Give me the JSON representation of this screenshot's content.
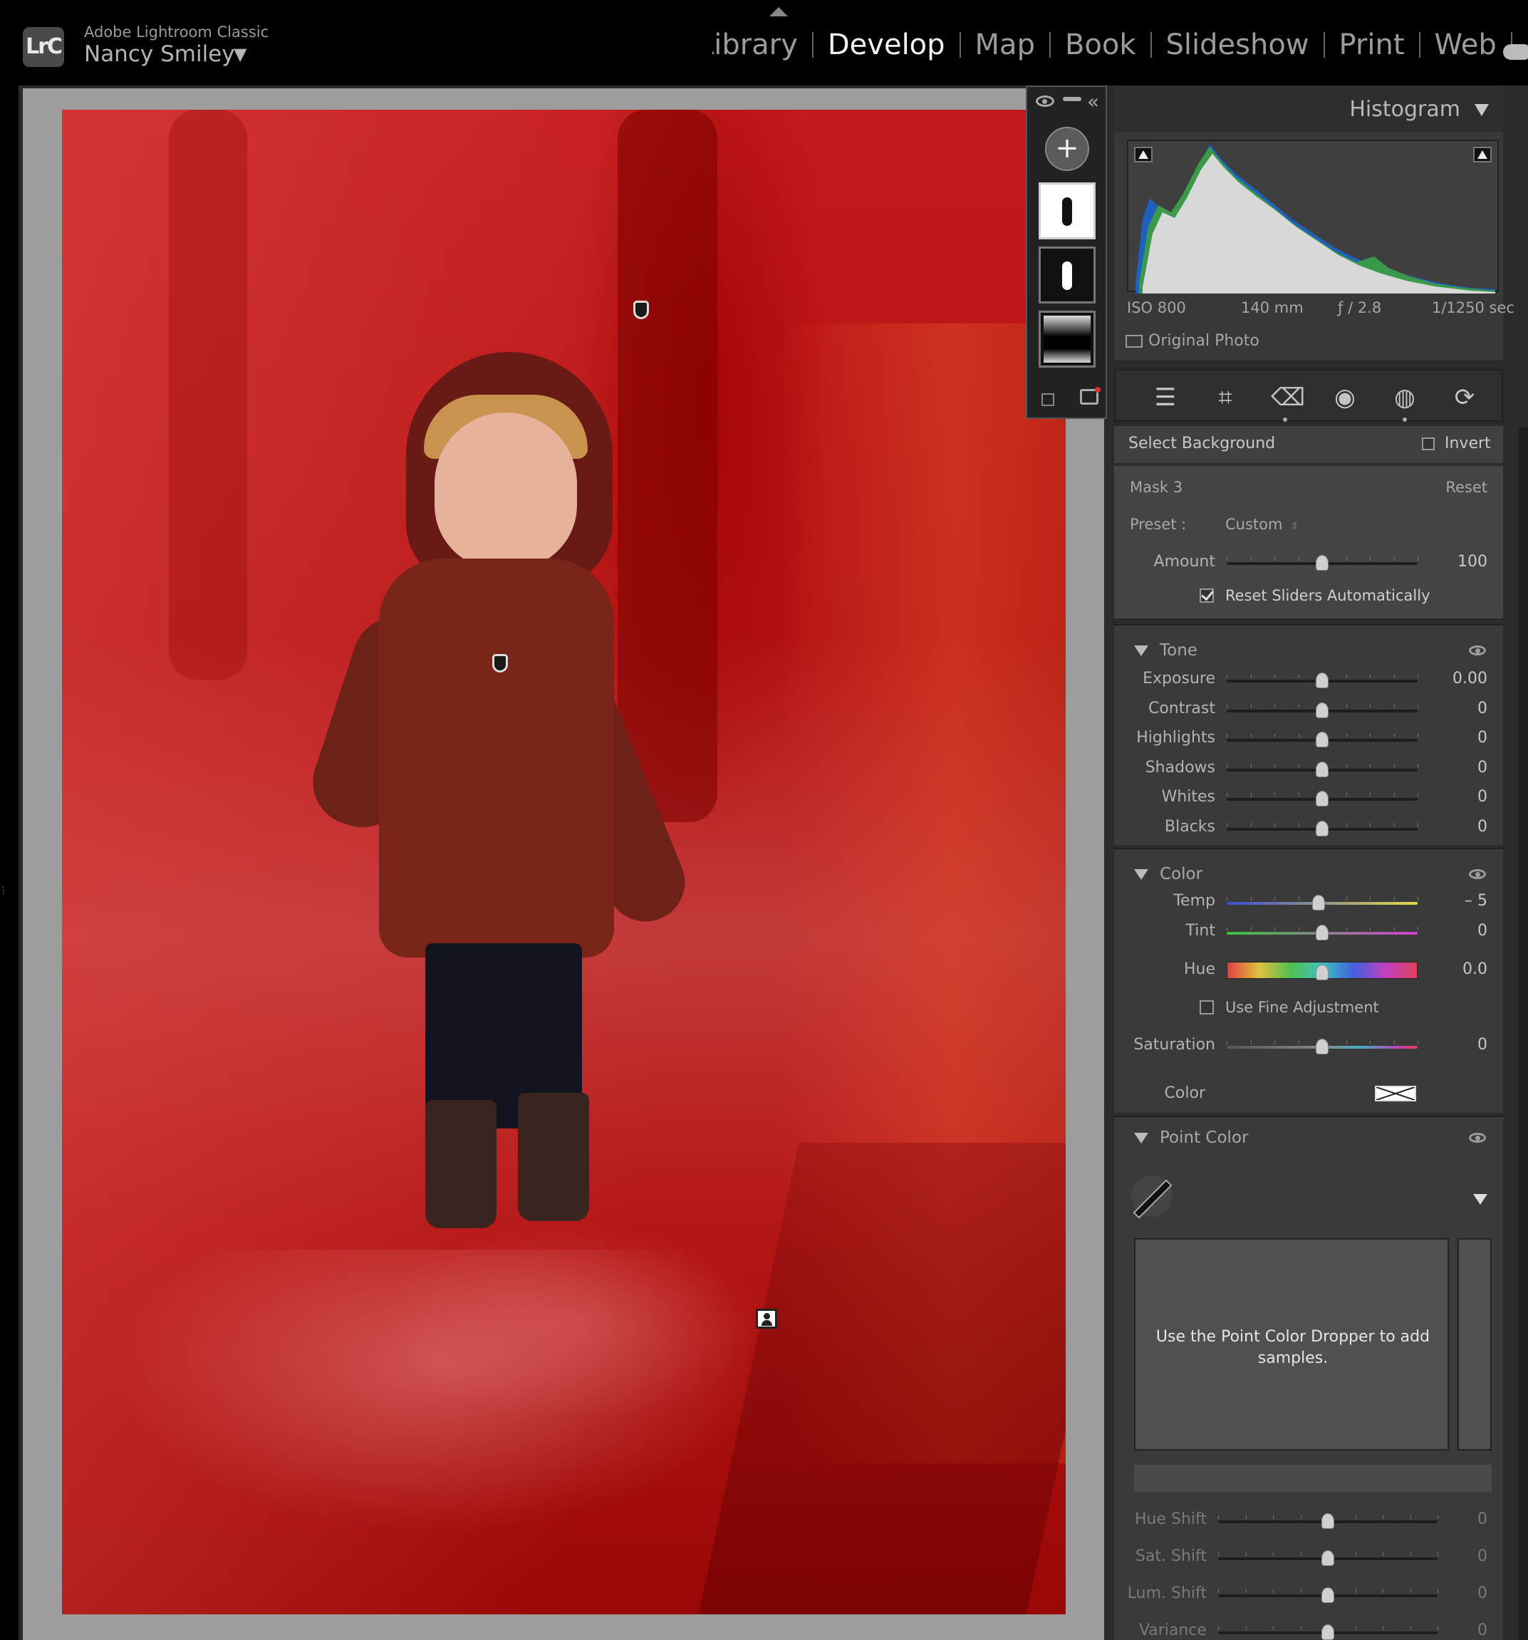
{
  "app": {
    "name": "Adobe Lightroom Classic",
    "logo_text": "LrC",
    "user": "Nancy Smiley",
    "user_caret": "▼"
  },
  "modules": [
    "Library",
    "Develop",
    "Map",
    "Book",
    "Slideshow",
    "Print",
    "Web"
  ],
  "active_module": "Develop",
  "histogram": {
    "title": "Histogram",
    "iso": "ISO 800",
    "focal": "140 mm",
    "aperture": "ƒ / 2.8",
    "shutter": "1/1250 sec",
    "original_photo_label": "Original Photo"
  },
  "tools": [
    "sliders-icon",
    "crop-icon",
    "heal-icon",
    "redeye-icon",
    "mask-icon",
    "reset-icon"
  ],
  "mask": {
    "select_label": "Select Background",
    "invert_label": "Invert",
    "name": "Mask 3",
    "reset_label": "Reset",
    "preset_label": "Preset :",
    "preset_value": "Custom",
    "amount_label": "Amount",
    "amount_value": "100",
    "amount_pos": 0.5,
    "reset_sliders_label": "Reset Sliders Automatically",
    "reset_sliders_checked": true
  },
  "tone": {
    "title": "Tone",
    "sliders": [
      {
        "label": "Exposure",
        "value": "0.00",
        "pos": 0.5
      },
      {
        "label": "Contrast",
        "value": "0",
        "pos": 0.5
      },
      {
        "label": "Highlights",
        "value": "0",
        "pos": 0.5
      },
      {
        "label": "Shadows",
        "value": "0",
        "pos": 0.5
      },
      {
        "label": "Whites",
        "value": "0",
        "pos": 0.5
      },
      {
        "label": "Blacks",
        "value": "0",
        "pos": 0.5
      }
    ]
  },
  "color": {
    "title": "Color",
    "temp_label": "Temp",
    "temp_value": "– 5",
    "temp_pos": 0.48,
    "tint_label": "Tint",
    "tint_value": "0",
    "tint_pos": 0.5,
    "hue_label": "Hue",
    "hue_value": "0.0",
    "hue_pos": 0.5,
    "fine_label": "Use Fine Adjustment",
    "saturation_label": "Saturation",
    "saturation_value": "0",
    "saturation_pos": 0.5,
    "color_label": "Color"
  },
  "point_color": {
    "title": "Point Color",
    "hint": "Use the Point Color Dropper to add samples.",
    "sliders": [
      {
        "label": "Hue Shift",
        "value": "0",
        "pos": 0.5
      },
      {
        "label": "Sat. Shift",
        "value": "0",
        "pos": 0.5
      },
      {
        "label": "Lum. Shift",
        "value": "0",
        "pos": 0.5
      },
      {
        "label": "Variance",
        "value": "0",
        "pos": 0.5
      }
    ]
  },
  "colors": {
    "mask_overlay": "#b51313",
    "panel_bg": "#3a3a3a",
    "active_text": "#f2f2f2"
  }
}
